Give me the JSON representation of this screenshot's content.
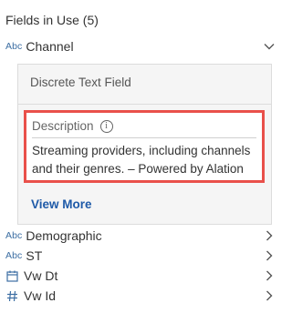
{
  "panel": {
    "title": "Fields in Use (5)"
  },
  "fields": [
    {
      "type_label": "Abc",
      "type_icon": "abc-text-icon",
      "name": "Channel",
      "chevron": "chevron-down-icon"
    },
    {
      "type_label": "Abc",
      "type_icon": "abc-text-icon",
      "name": "Demographic",
      "chevron": "chevron-right-icon"
    },
    {
      "type_label": "Abc",
      "type_icon": "abc-text-icon",
      "name": "ST",
      "chevron": "chevron-right-icon"
    },
    {
      "type_label": "",
      "type_icon": "calendar-icon",
      "name": "Vw Dt",
      "chevron": "chevron-right-icon"
    },
    {
      "type_label": "",
      "type_icon": "hash-number-icon",
      "name": "Vw Id",
      "chevron": "chevron-right-icon"
    }
  ],
  "detail_card": {
    "field_type": "Discrete Text Field",
    "description_label": "Description",
    "description_text": "Streaming providers, including channels and their genres. – Powered by Alation",
    "view_more_label": "View More",
    "highlight_color": "#e9504a",
    "link_color": "#1f5aa8"
  },
  "colors": {
    "type_icon": "#3c6ea3",
    "card_background": "#f5f5f5"
  }
}
